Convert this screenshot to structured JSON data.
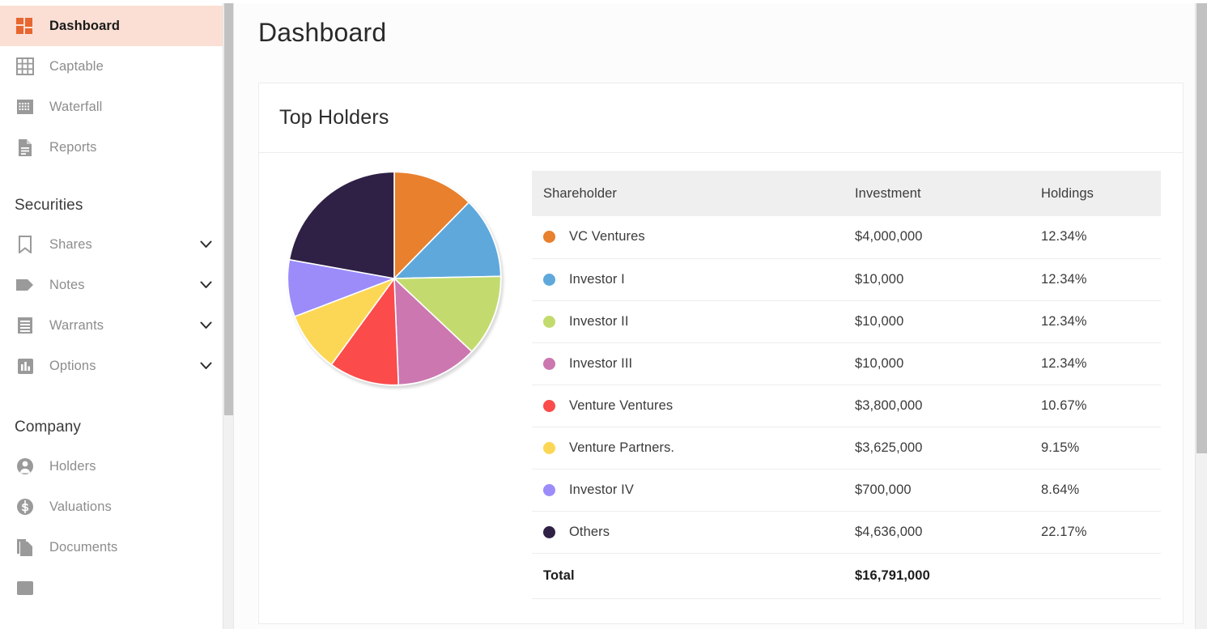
{
  "sidebar": {
    "primary_items": [
      {
        "label": "Dashboard",
        "icon": "dashboard-grid-icon",
        "active": true,
        "expandable": false
      },
      {
        "label": "Captable",
        "icon": "table-grid-icon",
        "active": false,
        "expandable": false
      },
      {
        "label": "Waterfall",
        "icon": "waterfall-icon",
        "active": false,
        "expandable": false
      },
      {
        "label": "Reports",
        "icon": "document-report-icon",
        "active": false,
        "expandable": false
      }
    ],
    "securities": {
      "title": "Securities",
      "items": [
        {
          "label": "Shares",
          "icon": "bookmark-icon",
          "expandable": true
        },
        {
          "label": "Notes",
          "icon": "tag-icon",
          "expandable": true
        },
        {
          "label": "Warrants",
          "icon": "receipt-icon",
          "expandable": true
        },
        {
          "label": "Options",
          "icon": "bar-chart-icon",
          "expandable": true
        }
      ]
    },
    "company": {
      "title": "Company",
      "items": [
        {
          "label": "Holders",
          "icon": "person-circle-icon",
          "expandable": false
        },
        {
          "label": "Valuations",
          "icon": "dollar-circle-icon",
          "expandable": false
        },
        {
          "label": "Documents",
          "icon": "documents-copy-icon",
          "expandable": false
        }
      ]
    },
    "active_highlight_color": "#fbdfd4",
    "accent_color": "#e8662f"
  },
  "header": {
    "page_title": "Dashboard"
  },
  "card": {
    "title": "Top Holders"
  },
  "table": {
    "columns": [
      "Shareholder",
      "Investment",
      "Holdings"
    ],
    "rows": [
      {
        "shareholder": "VC Ventures",
        "investment": "$4,000,000",
        "holdings": "12.34%",
        "color": "#e8802e"
      },
      {
        "shareholder": "Investor I",
        "investment": "$10,000",
        "holdings": "12.34%",
        "color": "#5fa8dc"
      },
      {
        "shareholder": "Investor II",
        "investment": "$10,000",
        "holdings": "12.34%",
        "color": "#c3db6e"
      },
      {
        "shareholder": "Investor III",
        "investment": "$10,000",
        "holdings": "12.34%",
        "color": "#cc77b0"
      },
      {
        "shareholder": "Venture Ventures",
        "investment": "$3,800,000",
        "holdings": "10.67%",
        "color": "#fb4b4b"
      },
      {
        "shareholder": "Venture Partners.",
        "investment": "$3,625,000",
        "holdings": "9.15%",
        "color": "#fcd755"
      },
      {
        "shareholder": "Investor IV",
        "investment": "$700,000",
        "holdings": "8.64%",
        "color": "#9b8cfa"
      },
      {
        "shareholder": "Others",
        "investment": "$4,636,000",
        "holdings": "22.17%",
        "color": "#2f2045"
      }
    ],
    "total": {
      "label": "Total",
      "investment": "$16,791,000",
      "holdings": ""
    }
  },
  "chart_data": {
    "type": "pie",
    "title": "Top Holders",
    "legend_position": "right-table",
    "start_angle_deg": 0,
    "direction": "clockwise",
    "categories": [
      "VC Ventures",
      "Investor I",
      "Investor II",
      "Investor III",
      "Venture Ventures",
      "Venture Partners.",
      "Investor IV",
      "Others"
    ],
    "values": [
      12.34,
      12.34,
      12.34,
      12.34,
      10.67,
      9.15,
      8.64,
      22.17
    ],
    "value_unit": "percent",
    "investments": [
      4000000,
      10000,
      10000,
      10000,
      3800000,
      3625000,
      700000,
      4636000
    ],
    "colors": [
      "#e8802e",
      "#5fa8dc",
      "#c3db6e",
      "#cc77b0",
      "#fb4b4b",
      "#fcd755",
      "#9b8cfa",
      "#2f2045"
    ]
  }
}
